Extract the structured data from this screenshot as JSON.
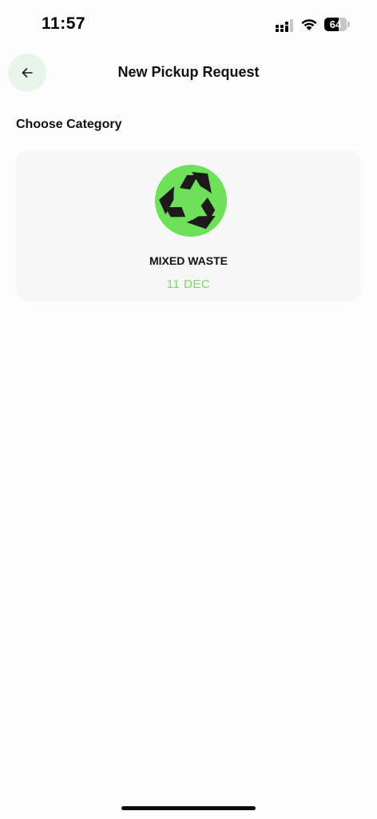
{
  "status_bar": {
    "time": "11:57",
    "battery_level": "64",
    "signal_icon": "cellular-signal-icon",
    "wifi_icon": "wifi-icon",
    "battery_icon": "battery-icon"
  },
  "header": {
    "back_icon": "arrow-left-icon",
    "title": "New Pickup Request"
  },
  "section": {
    "title": "Choose Category"
  },
  "categories": [
    {
      "name": "MIXED WASTE",
      "date": "11 DEC",
      "icon": "recycle-icon"
    }
  ],
  "colors": {
    "accent_green": "#6ee05a",
    "back_button_bg": "#e8f6ea",
    "card_bg": "#f7f7f7"
  }
}
